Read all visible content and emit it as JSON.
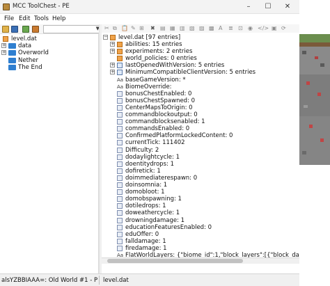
{
  "window": {
    "title": "MCC ToolChest - PE"
  },
  "menu": [
    "File",
    "Edit",
    "Tools",
    "Help"
  ],
  "left_tree": [
    {
      "label": "level.dat",
      "expander": ""
    },
    {
      "label": "data",
      "expander": "+"
    },
    {
      "label": "Overworld",
      "expander": "+"
    },
    {
      "label": "Nether",
      "expander": ""
    },
    {
      "label": "The End",
      "expander": ""
    }
  ],
  "root": {
    "label": "level.dat [97 entries]",
    "expander": "−"
  },
  "entries": [
    {
      "label": "abilities: 15 entries",
      "icon": "compound-icon",
      "expander": "+"
    },
    {
      "label": "experiments: 2 entries",
      "icon": "compound-icon",
      "expander": "+"
    },
    {
      "label": "world_policies: 0 entries",
      "icon": "compound-icon",
      "expander": ""
    },
    {
      "label": "lastOpenedWithVersion: 5 entries",
      "icon": "list-icon",
      "expander": "+"
    },
    {
      "label": "MinimumCompatibleClientVersion: 5 entries",
      "icon": "list-icon",
      "expander": "+"
    },
    {
      "label": "baseGameVersion: *",
      "icon": "string-icon",
      "expander": ""
    },
    {
      "label": "BiomeOverride:",
      "icon": "string-icon",
      "expander": ""
    },
    {
      "label": "bonusChestEnabled: 0",
      "icon": "byte-icon",
      "expander": ""
    },
    {
      "label": "bonusChestSpawned: 0",
      "icon": "byte-icon",
      "expander": ""
    },
    {
      "label": "CenterMapsToOrigin: 0",
      "icon": "byte-icon",
      "expander": ""
    },
    {
      "label": "commandblockoutput: 0",
      "icon": "byte-icon",
      "expander": ""
    },
    {
      "label": "commandblocksenabled: 1",
      "icon": "byte-icon",
      "expander": ""
    },
    {
      "label": "commandsEnabled: 0",
      "icon": "byte-icon",
      "expander": ""
    },
    {
      "label": "ConfirmedPlatformLockedContent: 0",
      "icon": "byte-icon",
      "expander": ""
    },
    {
      "label": "currentTick: 111402",
      "icon": "long-icon",
      "expander": ""
    },
    {
      "label": "Difficulty: 2",
      "icon": "int-icon",
      "expander": ""
    },
    {
      "label": "dodaylightcycle: 1",
      "icon": "byte-icon",
      "expander": ""
    },
    {
      "label": "doentitydrops: 1",
      "icon": "byte-icon",
      "expander": ""
    },
    {
      "label": "dofiretick: 1",
      "icon": "byte-icon",
      "expander": ""
    },
    {
      "label": "doimmediaterespawn: 0",
      "icon": "byte-icon",
      "expander": ""
    },
    {
      "label": "doinsomnia: 1",
      "icon": "byte-icon",
      "expander": ""
    },
    {
      "label": "domobloot: 1",
      "icon": "byte-icon",
      "expander": ""
    },
    {
      "label": "domobspawning: 1",
      "icon": "byte-icon",
      "expander": ""
    },
    {
      "label": "dotiledrops: 1",
      "icon": "byte-icon",
      "expander": ""
    },
    {
      "label": "doweathercycle: 1",
      "icon": "byte-icon",
      "expander": ""
    },
    {
      "label": "drowningdamage: 1",
      "icon": "byte-icon",
      "expander": ""
    },
    {
      "label": "educationFeaturesEnabled: 0",
      "icon": "byte-icon",
      "expander": ""
    },
    {
      "label": "eduOffer: 0",
      "icon": "int-icon",
      "expander": ""
    },
    {
      "label": "falldamage: 1",
      "icon": "byte-icon",
      "expander": ""
    },
    {
      "label": "firedamage: 1",
      "icon": "byte-icon",
      "expander": ""
    },
    {
      "label": "FlatWorldLayers: {\"biome_id\":1,\"block_layers\":[{\"block_data\":0,\"block",
      "icon": "string-icon",
      "expander": ""
    }
  ],
  "status": {
    "world": "alsYZBBIAAA=: Old World #1 - Plains Villag",
    "file": "level.dat"
  },
  "colors": {
    "folder": "#2f7fd0",
    "compound": "#f0a34a",
    "accent": "#0078d7"
  }
}
